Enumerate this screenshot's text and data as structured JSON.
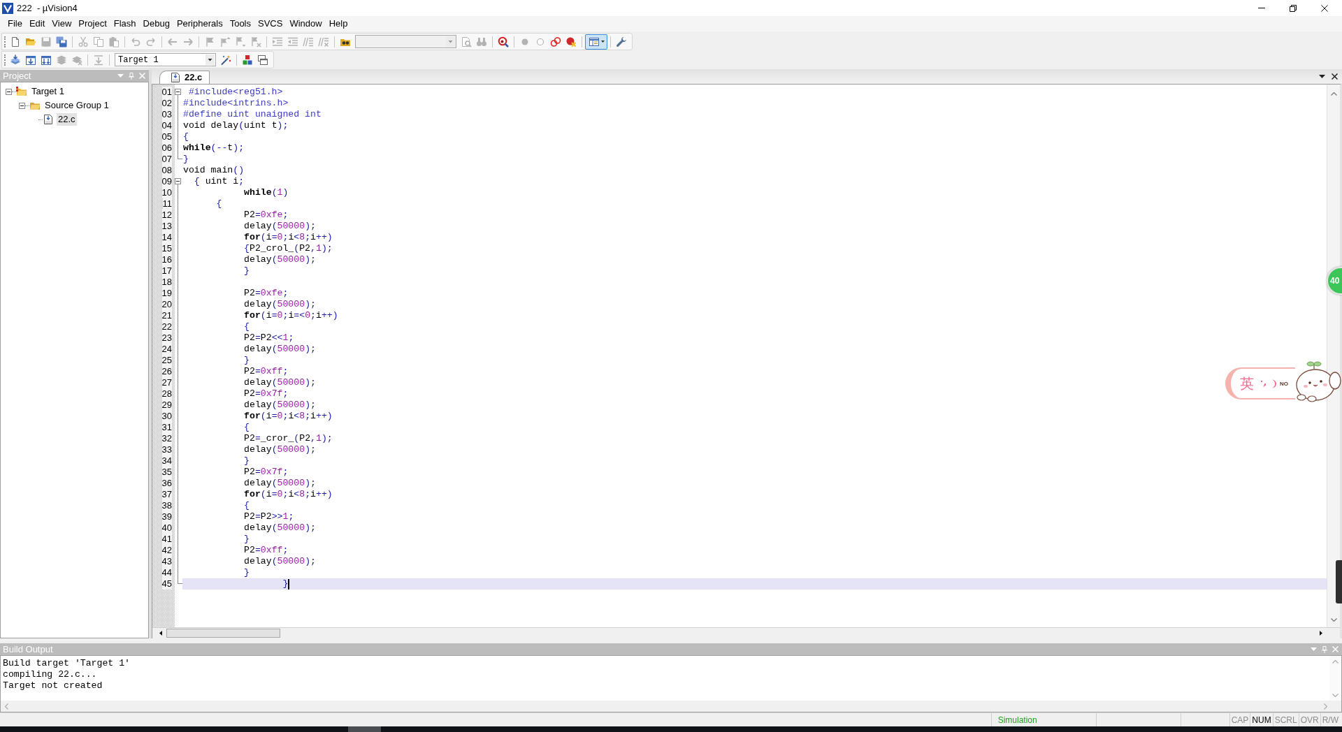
{
  "window": {
    "title": "222  - µVision4"
  },
  "menu": [
    "File",
    "Edit",
    "View",
    "Project",
    "Flash",
    "Debug",
    "Peripherals",
    "Tools",
    "SVCS",
    "Window",
    "Help"
  ],
  "toolbars": [
    {
      "groups": [
        [
          {
            "kind": "new",
            "disabled": false,
            "pressed": false
          },
          {
            "kind": "open",
            "disabled": false,
            "pressed": false
          },
          {
            "kind": "save",
            "disabled": true,
            "pressed": false
          },
          {
            "kind": "saveall",
            "disabled": false,
            "pressed": false
          }
        ],
        [
          {
            "kind": "cut",
            "disabled": true,
            "pressed": false
          },
          {
            "kind": "copy",
            "disabled": true,
            "pressed": false
          },
          {
            "kind": "paste",
            "disabled": true,
            "pressed": false
          }
        ],
        [
          {
            "kind": "undo",
            "disabled": true,
            "pressed": false
          },
          {
            "kind": "redo",
            "disabled": true,
            "pressed": false
          }
        ],
        [
          {
            "kind": "back",
            "disabled": true,
            "pressed": false
          },
          {
            "kind": "forward",
            "disabled": true,
            "pressed": false
          }
        ],
        [
          {
            "kind": "bookmark",
            "disabled": true,
            "pressed": false
          },
          {
            "kind": "prevmark",
            "disabled": true,
            "pressed": false
          },
          {
            "kind": "nextmark",
            "disabled": true,
            "pressed": false
          },
          {
            "kind": "clearmarks",
            "disabled": true,
            "pressed": false
          }
        ],
        [
          {
            "kind": "indent",
            "disabled": true,
            "pressed": false
          },
          {
            "kind": "outdent",
            "disabled": true,
            "pressed": false
          },
          {
            "kind": "comment",
            "disabled": true,
            "pressed": false
          },
          {
            "kind": "uncomment",
            "disabled": true,
            "pressed": false
          }
        ],
        [
          {
            "kind": "findfiles",
            "disabled": false,
            "pressed": false
          },
          {
            "kind": "combo",
            "disabled": true,
            "pressed": false
          },
          {
            "kind": "find",
            "disabled": true,
            "pressed": false
          },
          {
            "kind": "isearch",
            "disabled": true,
            "pressed": false
          }
        ],
        [
          {
            "kind": "debug",
            "disabled": false,
            "pressed": false
          }
        ],
        [
          {
            "kind": "breakpoint",
            "disabled": true,
            "pressed": false
          },
          {
            "kind": "togglebp",
            "disabled": true,
            "pressed": false
          },
          {
            "kind": "disablebp",
            "disabled": false,
            "pressed": false
          },
          {
            "kind": "killbp",
            "disabled": false,
            "pressed": false
          }
        ],
        [
          {
            "kind": "layout",
            "disabled": false,
            "pressed": true
          }
        ],
        [
          {
            "kind": "configure",
            "disabled": false,
            "pressed": false
          }
        ]
      ]
    },
    {
      "groups": [
        [
          {
            "kind": "translate",
            "disabled": false,
            "pressed": false
          },
          {
            "kind": "build",
            "disabled": false,
            "pressed": false
          },
          {
            "kind": "rebuild",
            "disabled": false,
            "pressed": false
          },
          {
            "kind": "batch",
            "disabled": true,
            "pressed": false
          },
          {
            "kind": "stop",
            "disabled": true,
            "pressed": false
          }
        ],
        [
          {
            "kind": "load",
            "disabled": true,
            "pressed": false
          }
        ],
        [
          {
            "kind": "combo",
            "value": "Target 1",
            "disabled": false,
            "pressed": false
          },
          {
            "kind": "options",
            "disabled": false,
            "pressed": false
          }
        ],
        [
          {
            "kind": "manage",
            "disabled": false,
            "pressed": false
          },
          {
            "kind": "windows",
            "disabled": false,
            "pressed": false
          }
        ]
      ]
    }
  ],
  "project": {
    "title": "Project",
    "tree": [
      {
        "label": "Target 1",
        "kind": "target",
        "expanded": true,
        "selected": false,
        "children": [
          {
            "label": "Source Group 1",
            "kind": "group",
            "expanded": true,
            "selected": false,
            "children": [
              {
                "label": "22.c",
                "kind": "file",
                "selected": true
              }
            ]
          }
        ]
      }
    ]
  },
  "editor": {
    "tabs": [
      {
        "label": "22.c",
        "selected": true
      }
    ],
    "lines": [
      {
        "number": "01",
        "kind": "foldstart",
        "current": false,
        "tokens": [
          {
            "text": " #include<reg51.h>",
            "kind": "preprocessor"
          }
        ]
      },
      {
        "number": "02",
        "kind": "code",
        "current": false,
        "tokens": [
          {
            "text": "#include<intrins.h>",
            "kind": "preprocessor"
          }
        ]
      },
      {
        "number": "03",
        "kind": "code",
        "current": false,
        "tokens": [
          {
            "text": "#define uint unaigned int",
            "kind": "preprocessor"
          }
        ]
      },
      {
        "number": "04",
        "kind": "code",
        "current": false,
        "tokens": [
          {
            "text": "void delay",
            "kind": "plain"
          },
          {
            "text": "(",
            "kind": "operator"
          },
          {
            "text": "uint t",
            "kind": "plain"
          },
          {
            "text": ");",
            "kind": "operator"
          }
        ]
      },
      {
        "number": "05",
        "kind": "code",
        "current": false,
        "tokens": [
          {
            "text": "{",
            "kind": "operator"
          }
        ]
      },
      {
        "number": "06",
        "kind": "code",
        "current": false,
        "tokens": [
          {
            "text": "while",
            "kind": "keyword"
          },
          {
            "text": "(--",
            "kind": "operator"
          },
          {
            "text": "t",
            "kind": "plain"
          },
          {
            "text": ");",
            "kind": "operator"
          }
        ]
      },
      {
        "number": "07",
        "kind": "foldend",
        "current": false,
        "tokens": [
          {
            "text": "}",
            "kind": "operator"
          }
        ]
      },
      {
        "number": "08",
        "kind": "code",
        "current": false,
        "tokens": [
          {
            "text": "void main",
            "kind": "plain"
          },
          {
            "text": "()",
            "kind": "operator"
          }
        ]
      },
      {
        "number": "09",
        "kind": "foldstart",
        "current": false,
        "tokens": [
          {
            "text": "  {",
            "kind": "operator"
          },
          {
            "text": " uint i",
            "kind": "plain"
          },
          {
            "text": ";",
            "kind": "operator"
          }
        ]
      },
      {
        "number": "10",
        "kind": "code",
        "current": false,
        "tokens": [
          {
            "text": "           while",
            "kind": "keyword"
          },
          {
            "text": "(",
            "kind": "operator"
          },
          {
            "text": "1",
            "kind": "number"
          },
          {
            "text": ")",
            "kind": "operator"
          }
        ]
      },
      {
        "number": "11",
        "kind": "code",
        "current": false,
        "tokens": [
          {
            "text": "      {",
            "kind": "operator"
          }
        ]
      },
      {
        "number": "12",
        "kind": "code",
        "current": false,
        "tokens": [
          {
            "text": "           P2",
            "kind": "plain"
          },
          {
            "text": "=",
            "kind": "operator"
          },
          {
            "text": "0xfe",
            "kind": "number"
          },
          {
            "text": ";",
            "kind": "operator"
          }
        ]
      },
      {
        "number": "13",
        "kind": "code",
        "current": false,
        "tokens": [
          {
            "text": "           delay",
            "kind": "plain"
          },
          {
            "text": "(",
            "kind": "operator"
          },
          {
            "text": "50000",
            "kind": "number"
          },
          {
            "text": ");",
            "kind": "operator"
          }
        ]
      },
      {
        "number": "14",
        "kind": "code",
        "current": false,
        "tokens": [
          {
            "text": "           for",
            "kind": "keyword"
          },
          {
            "text": "(",
            "kind": "operator"
          },
          {
            "text": "i",
            "kind": "plain"
          },
          {
            "text": "=",
            "kind": "operator"
          },
          {
            "text": "0",
            "kind": "number"
          },
          {
            "text": ";",
            "kind": "operator"
          },
          {
            "text": "i",
            "kind": "plain"
          },
          {
            "text": "<",
            "kind": "operator"
          },
          {
            "text": "8",
            "kind": "number"
          },
          {
            "text": ";",
            "kind": "operator"
          },
          {
            "text": "i",
            "kind": "plain"
          },
          {
            "text": "++)",
            "kind": "operator"
          }
        ]
      },
      {
        "number": "15",
        "kind": "code",
        "current": false,
        "tokens": [
          {
            "text": "           {",
            "kind": "operator"
          },
          {
            "text": "P2_crol_",
            "kind": "plain"
          },
          {
            "text": "(",
            "kind": "operator"
          },
          {
            "text": "P2",
            "kind": "plain"
          },
          {
            "text": ",",
            "kind": "operator"
          },
          {
            "text": "1",
            "kind": "number"
          },
          {
            "text": ");",
            "kind": "operator"
          }
        ]
      },
      {
        "number": "16",
        "kind": "code",
        "current": false,
        "tokens": [
          {
            "text": "           delay",
            "kind": "plain"
          },
          {
            "text": "(",
            "kind": "operator"
          },
          {
            "text": "50000",
            "kind": "number"
          },
          {
            "text": ");",
            "kind": "operator"
          }
        ]
      },
      {
        "number": "17",
        "kind": "code",
        "current": false,
        "tokens": [
          {
            "text": "           }",
            "kind": "operator"
          }
        ]
      },
      {
        "number": "18",
        "kind": "code",
        "current": false
      },
      {
        "number": "19",
        "kind": "code",
        "current": false,
        "tokens": [
          {
            "text": "           P2",
            "kind": "plain"
          },
          {
            "text": "=",
            "kind": "operator"
          },
          {
            "text": "0xfe",
            "kind": "number"
          },
          {
            "text": ";",
            "kind": "operator"
          }
        ]
      },
      {
        "number": "20",
        "kind": "code",
        "current": false,
        "tokens": [
          {
            "text": "           delay",
            "kind": "plain"
          },
          {
            "text": "(",
            "kind": "operator"
          },
          {
            "text": "50000",
            "kind": "number"
          },
          {
            "text": ");",
            "kind": "operator"
          }
        ]
      },
      {
        "number": "21",
        "kind": "code",
        "current": false,
        "tokens": [
          {
            "text": "           for",
            "kind": "keyword"
          },
          {
            "text": "(",
            "kind": "operator"
          },
          {
            "text": "i",
            "kind": "plain"
          },
          {
            "text": "=",
            "kind": "operator"
          },
          {
            "text": "0",
            "kind": "number"
          },
          {
            "text": ";",
            "kind": "operator"
          },
          {
            "text": "i",
            "kind": "plain"
          },
          {
            "text": "=<",
            "kind": "operator"
          },
          {
            "text": "0",
            "kind": "number"
          },
          {
            "text": ";",
            "kind": "operator"
          },
          {
            "text": "i",
            "kind": "plain"
          },
          {
            "text": "++)",
            "kind": "operator"
          }
        ]
      },
      {
        "number": "22",
        "kind": "code",
        "current": false,
        "tokens": [
          {
            "text": "           {",
            "kind": "operator"
          }
        ]
      },
      {
        "number": "23",
        "kind": "code",
        "current": false,
        "tokens": [
          {
            "text": "           P2",
            "kind": "plain"
          },
          {
            "text": "=",
            "kind": "operator"
          },
          {
            "text": "P2",
            "kind": "plain"
          },
          {
            "text": "<<",
            "kind": "operator"
          },
          {
            "text": "1",
            "kind": "number"
          },
          {
            "text": ";",
            "kind": "operator"
          }
        ]
      },
      {
        "number": "24",
        "kind": "code",
        "current": false,
        "tokens": [
          {
            "text": "           delay",
            "kind": "plain"
          },
          {
            "text": "(",
            "kind": "operator"
          },
          {
            "text": "50000",
            "kind": "number"
          },
          {
            "text": ");",
            "kind": "operator"
          }
        ]
      },
      {
        "number": "25",
        "kind": "code",
        "current": false,
        "tokens": [
          {
            "text": "           }",
            "kind": "operator"
          }
        ]
      },
      {
        "number": "26",
        "kind": "code",
        "current": false,
        "tokens": [
          {
            "text": "           P2",
            "kind": "plain"
          },
          {
            "text": "=",
            "kind": "operator"
          },
          {
            "text": "0xff",
            "kind": "number"
          },
          {
            "text": ";",
            "kind": "operator"
          }
        ]
      },
      {
        "number": "27",
        "kind": "code",
        "current": false,
        "tokens": [
          {
            "text": "           delay",
            "kind": "plain"
          },
          {
            "text": "(",
            "kind": "operator"
          },
          {
            "text": "50000",
            "kind": "number"
          },
          {
            "text": ");",
            "kind": "operator"
          }
        ]
      },
      {
        "number": "28",
        "kind": "code",
        "current": false,
        "tokens": [
          {
            "text": "           P2",
            "kind": "plain"
          },
          {
            "text": "=",
            "kind": "operator"
          },
          {
            "text": "0x7f",
            "kind": "number"
          },
          {
            "text": ";",
            "kind": "operator"
          }
        ]
      },
      {
        "number": "29",
        "kind": "code",
        "current": false,
        "tokens": [
          {
            "text": "           delay",
            "kind": "plain"
          },
          {
            "text": "(",
            "kind": "operator"
          },
          {
            "text": "50000",
            "kind": "number"
          },
          {
            "text": ");",
            "kind": "operator"
          }
        ]
      },
      {
        "number": "30",
        "kind": "code",
        "current": false,
        "tokens": [
          {
            "text": "           for",
            "kind": "keyword"
          },
          {
            "text": "(",
            "kind": "operator"
          },
          {
            "text": "i",
            "kind": "plain"
          },
          {
            "text": "=",
            "kind": "operator"
          },
          {
            "text": "0",
            "kind": "number"
          },
          {
            "text": ";",
            "kind": "operator"
          },
          {
            "text": "i",
            "kind": "plain"
          },
          {
            "text": "<",
            "kind": "operator"
          },
          {
            "text": "8",
            "kind": "number"
          },
          {
            "text": ";",
            "kind": "operator"
          },
          {
            "text": "i",
            "kind": "plain"
          },
          {
            "text": "++)",
            "kind": "operator"
          }
        ]
      },
      {
        "number": "31",
        "kind": "code",
        "current": false,
        "tokens": [
          {
            "text": "           {",
            "kind": "operator"
          }
        ]
      },
      {
        "number": "32",
        "kind": "code",
        "current": false,
        "tokens": [
          {
            "text": "           P2",
            "kind": "plain"
          },
          {
            "text": "=",
            "kind": "operator"
          },
          {
            "text": "_cror_",
            "kind": "plain"
          },
          {
            "text": "(",
            "kind": "operator"
          },
          {
            "text": "P2",
            "kind": "plain"
          },
          {
            "text": ",",
            "kind": "operator"
          },
          {
            "text": "1",
            "kind": "number"
          },
          {
            "text": ");",
            "kind": "operator"
          }
        ]
      },
      {
        "number": "33",
        "kind": "code",
        "current": false,
        "tokens": [
          {
            "text": "           delay",
            "kind": "plain"
          },
          {
            "text": "(",
            "kind": "operator"
          },
          {
            "text": "50000",
            "kind": "number"
          },
          {
            "text": ");",
            "kind": "operator"
          }
        ]
      },
      {
        "number": "34",
        "kind": "code",
        "current": false,
        "tokens": [
          {
            "text": "           }",
            "kind": "operator"
          }
        ]
      },
      {
        "number": "35",
        "kind": "code",
        "current": false,
        "tokens": [
          {
            "text": "           P2",
            "kind": "plain"
          },
          {
            "text": "=",
            "kind": "operator"
          },
          {
            "text": "0x7f",
            "kind": "number"
          },
          {
            "text": ";",
            "kind": "operator"
          }
        ]
      },
      {
        "number": "36",
        "kind": "code",
        "current": false,
        "tokens": [
          {
            "text": "           delay",
            "kind": "plain"
          },
          {
            "text": "(",
            "kind": "operator"
          },
          {
            "text": "50000",
            "kind": "number"
          },
          {
            "text": ");",
            "kind": "operator"
          }
        ]
      },
      {
        "number": "37",
        "kind": "code",
        "current": false,
        "tokens": [
          {
            "text": "           for",
            "kind": "keyword"
          },
          {
            "text": "(",
            "kind": "operator"
          },
          {
            "text": "i",
            "kind": "plain"
          },
          {
            "text": "=",
            "kind": "operator"
          },
          {
            "text": "0",
            "kind": "number"
          },
          {
            "text": ";",
            "kind": "operator"
          },
          {
            "text": "i",
            "kind": "plain"
          },
          {
            "text": "<",
            "kind": "operator"
          },
          {
            "text": "8",
            "kind": "number"
          },
          {
            "text": ";",
            "kind": "operator"
          },
          {
            "text": "i",
            "kind": "plain"
          },
          {
            "text": "++)",
            "kind": "operator"
          }
        ]
      },
      {
        "number": "38",
        "kind": "code",
        "current": false,
        "tokens": [
          {
            "text": "           {",
            "kind": "operator"
          }
        ]
      },
      {
        "number": "39",
        "kind": "code",
        "current": false,
        "tokens": [
          {
            "text": "           P2",
            "kind": "plain"
          },
          {
            "text": "=",
            "kind": "operator"
          },
          {
            "text": "P2",
            "kind": "plain"
          },
          {
            "text": ">>",
            "kind": "operator"
          },
          {
            "text": "1",
            "kind": "number"
          },
          {
            "text": ";",
            "kind": "operator"
          }
        ]
      },
      {
        "number": "40",
        "kind": "code",
        "current": false,
        "tokens": [
          {
            "text": "           delay",
            "kind": "plain"
          },
          {
            "text": "(",
            "kind": "operator"
          },
          {
            "text": "50000",
            "kind": "number"
          },
          {
            "text": ");",
            "kind": "operator"
          }
        ]
      },
      {
        "number": "41",
        "kind": "code",
        "current": false,
        "tokens": [
          {
            "text": "           }",
            "kind": "operator"
          }
        ]
      },
      {
        "number": "42",
        "kind": "code",
        "current": false,
        "tokens": [
          {
            "text": "           P2",
            "kind": "plain"
          },
          {
            "text": "=",
            "kind": "operator"
          },
          {
            "text": "0xff",
            "kind": "number"
          },
          {
            "text": ";",
            "kind": "operator"
          }
        ]
      },
      {
        "number": "43",
        "kind": "code",
        "current": false,
        "tokens": [
          {
            "text": "           delay",
            "kind": "plain"
          },
          {
            "text": "(",
            "kind": "operator"
          },
          {
            "text": "50000",
            "kind": "number"
          },
          {
            "text": ");",
            "kind": "operator"
          }
        ]
      },
      {
        "number": "44",
        "kind": "code",
        "current": false,
        "tokens": [
          {
            "text": "           }",
            "kind": "operator"
          }
        ]
      },
      {
        "number": "45",
        "kind": "foldend",
        "current": true,
        "tokens": [
          {
            "text": "                  }",
            "kind": "operator"
          }
        ]
      }
    ]
  },
  "build_output": {
    "title": "Build Output",
    "lines": [
      "Build target 'Target 1'",
      "compiling 22.c...",
      "Target not created"
    ]
  },
  "status_bar": {
    "mode": "Simulation",
    "indicators": [
      {
        "label": "CAP",
        "on": false
      },
      {
        "label": "NUM",
        "on": true
      },
      {
        "label": "SCRL",
        "on": false
      },
      {
        "label": "OVR",
        "on": false
      },
      {
        "label": "R/W",
        "on": false
      }
    ]
  },
  "desktop": {
    "speed_badge": "40",
    "input_method": {
      "mode": "英",
      "caption": "NO"
    }
  }
}
